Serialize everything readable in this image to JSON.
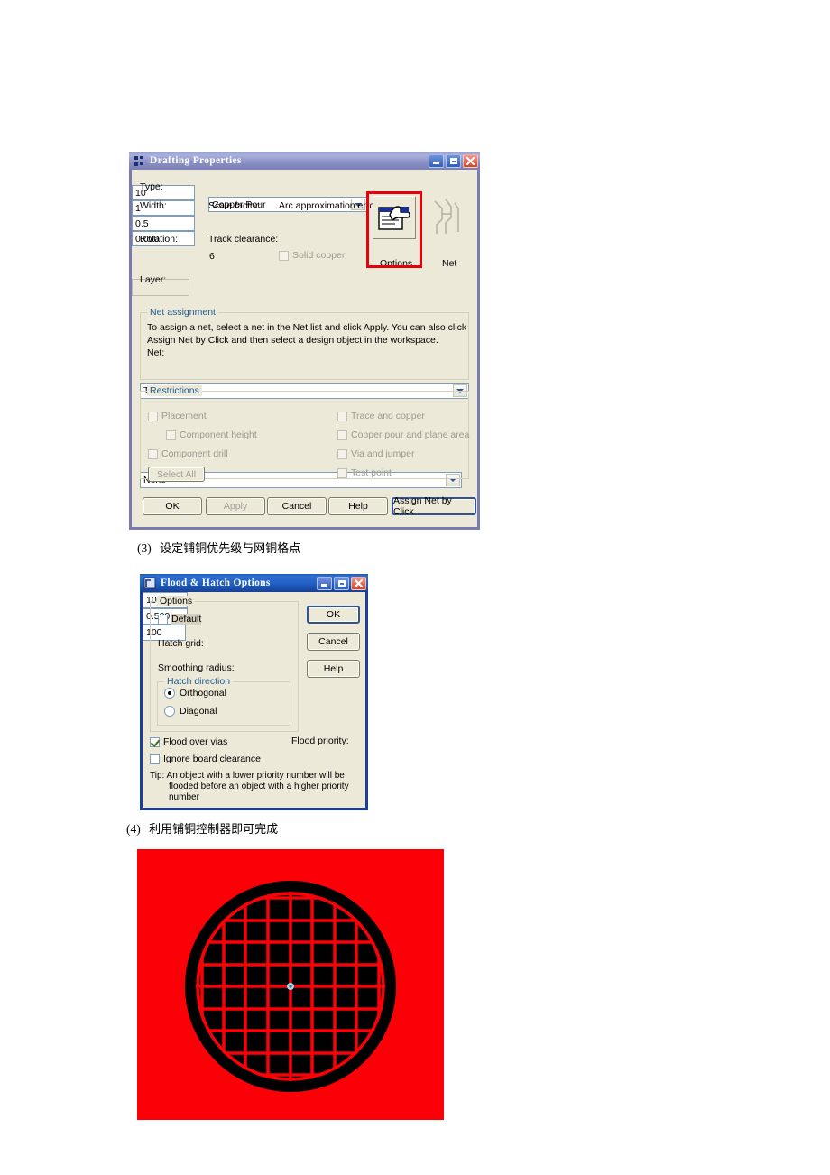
{
  "page": {
    "background": "#ffffff"
  },
  "dialog1": {
    "title": "Drafting Properties",
    "icon": "drafting-properties-icon",
    "window_buttons": {
      "minimize": "minimize-icon",
      "maximize": "maximize-icon",
      "close": "close-icon"
    },
    "fields": {
      "type_label": "Type:",
      "type_value": "Copper Pour",
      "width_label": "Width:",
      "width_value": "10",
      "scale_factor_label": "Scale factor:",
      "scale_factor_value": "1",
      "arc_label": "Arc approximation error:",
      "arc_value": "0.5",
      "rotation_label": "Rotation:",
      "rotation_value": "0.000",
      "track_clearance_label": "Track clearance:",
      "track_clearance_value": "6",
      "solid_copper_label": "Solid copper",
      "layer_label": "Layer:",
      "layer_value": "Top"
    },
    "toolbar": {
      "options_label": "Options",
      "options_icon": "hand-document-icon",
      "net_label": "Net",
      "net_icon": "net-trace-icon"
    },
    "net_assignment": {
      "group_label": "Net assignment",
      "description_line1": "To assign a net, select a net in the Net list and click Apply. You can also click",
      "description_line2": "Assign Net by Click and then select a design object in the workspace.",
      "net_label": "Net:",
      "net_value": "None"
    },
    "restrictions": {
      "group_label": "Restrictions",
      "placement": "Placement",
      "component_height": "Component height",
      "component_height_value": "",
      "component_drill": "Component drill",
      "select_all": "Select All",
      "trace_and_copper": "Trace and copper",
      "copper_pour_and_plane_area": "Copper pour and plane area",
      "via_and_jumper": "Via and jumper",
      "test_point": "Test point"
    },
    "buttons": {
      "ok": "OK",
      "apply": "Apply",
      "cancel": "Cancel",
      "help": "Help",
      "assign_net_by_click": "Assign Net by Click"
    },
    "annotation": {
      "highlight_color": "#e8000b",
      "highlight_target": "Options"
    }
  },
  "step3": {
    "number": "(3)",
    "text": "设定铺铜优先级与网铜格点"
  },
  "dialog2": {
    "title": "Flood & Hatch Options",
    "icon": "flood-hatch-icon",
    "window_buttons": {
      "minimize": "minimize-icon",
      "maximize": "maximize-icon",
      "close": "close-icon"
    },
    "options": {
      "group_label": "Options",
      "default_label": "Default",
      "hatch_grid_label": "Hatch grid:",
      "hatch_grid_value": "100",
      "smoothing_radius_label": "Smoothing radius:",
      "smoothing_radius_value": "0.500"
    },
    "hatch_direction": {
      "group_label": "Hatch direction",
      "orthogonal": "Orthogonal",
      "diagonal": "Diagonal",
      "selected": "Orthogonal"
    },
    "flood_over_vias": "Flood over vias",
    "ignore_board_clearance": "Ignore board clearance",
    "flood_priority_label": "Flood priority:",
    "flood_priority_value": "100",
    "tip_line1": "Tip: An object with a lower priority number will be",
    "tip_line2": "flooded before an object with a higher priority",
    "tip_line3": "number",
    "buttons": {
      "ok": "OK",
      "cancel": "Cancel",
      "help": "Help"
    }
  },
  "step4": {
    "number": "(4)",
    "text": "利用铺铜控制器即可完成"
  },
  "result_image": {
    "name": "copper-pour-hatch-result",
    "background_color": "#fb0007",
    "copper_color": "#000000",
    "hatch_color": "#fb0007",
    "origin_marker": "origin-crosshair-icon"
  }
}
